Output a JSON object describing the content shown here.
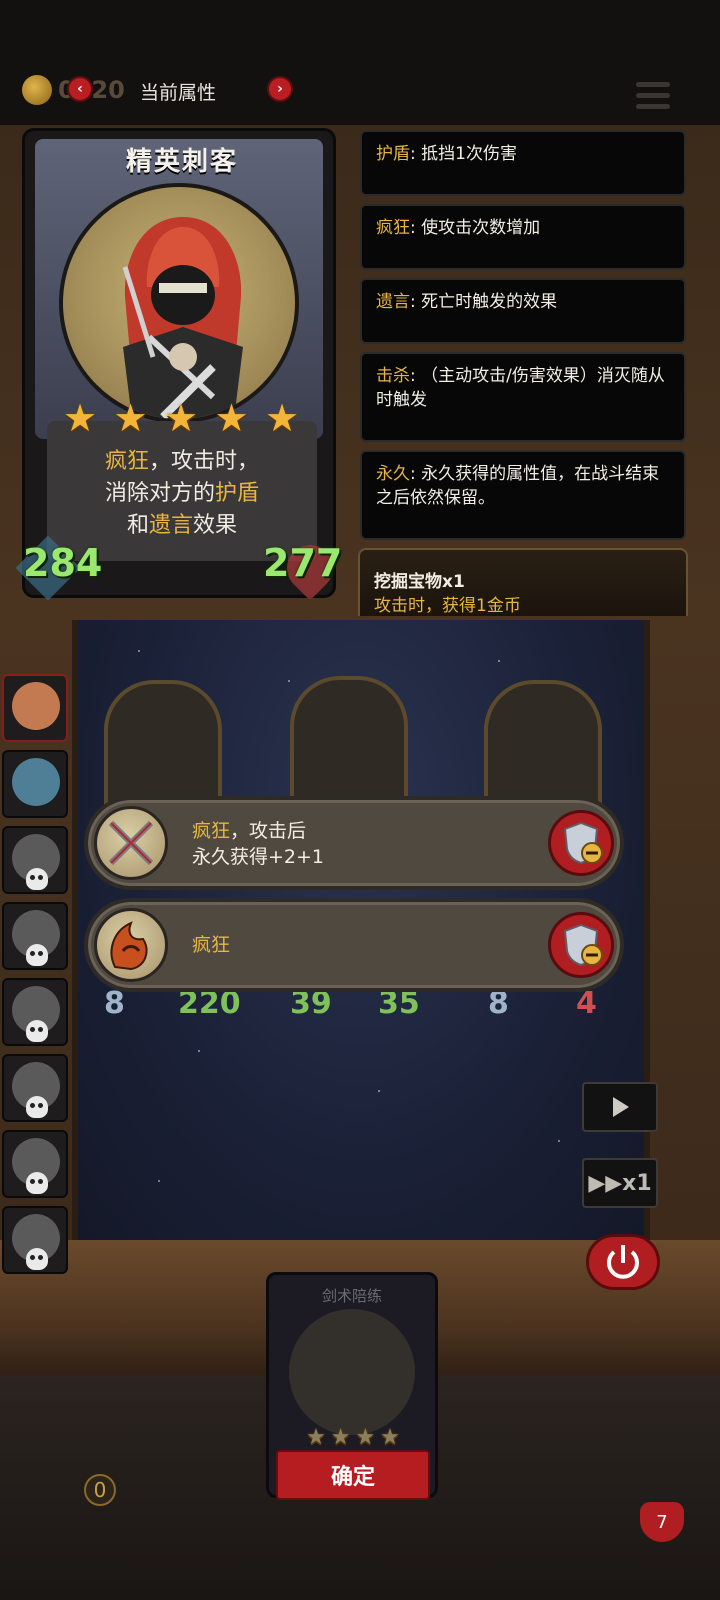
{
  "header": {
    "coin_value": "0020",
    "title": "当前属性",
    "prev_label": "‹",
    "next_label": "›"
  },
  "hero": {
    "name": "精英刺客",
    "stars": 5,
    "desc": {
      "line1_kw": "疯狂",
      "line1_rest": "，攻击时，",
      "line2_pre": "消除对方的",
      "line2_kw": "护盾",
      "line3_pre": "和",
      "line3_kw": "遗言",
      "line3_post": "效果"
    },
    "attack": "284",
    "health": "277"
  },
  "keywords": [
    {
      "name": "护盾",
      "text": ": 抵挡1次伤害"
    },
    {
      "name": "疯狂",
      "text": ": 使攻击次数增加"
    },
    {
      "name": "遗言",
      "text": ": 死亡时触发的效果"
    },
    {
      "name": "击杀",
      "text": ": （主动攻击/伤害效果）消灭随从时触发"
    },
    {
      "name": "永久",
      "text": ": 永久获得的属性值，在战斗结束之后依然保留。"
    }
  ],
  "treasure": {
    "name": "挖掘宝物x1",
    "effect": "攻击时，获得1金币"
  },
  "traits": [
    {
      "keyword": "疯狂",
      "rest": "，攻击后",
      "line2": "永久获得+2+1"
    },
    {
      "keyword": "疯狂",
      "rest": "",
      "line2": ""
    }
  ],
  "board_units": [
    {
      "attack": "8",
      "health": "220"
    },
    {
      "attack": "39",
      "health": "35"
    },
    {
      "attack": "8",
      "health": "4"
    }
  ],
  "controls": {
    "speed_label": "▶▶x1",
    "play_icon": "play-icon",
    "power_icon": "power-icon"
  },
  "bottom_card": {
    "title": "剑术陪练",
    "stars": 4,
    "confirm_label": "确定"
  },
  "footer": {
    "gold": "0",
    "lives": "7"
  },
  "colors": {
    "accent_gold": "#e8b640",
    "stat_green": "#9be86e",
    "button_red": "#b11e22"
  }
}
